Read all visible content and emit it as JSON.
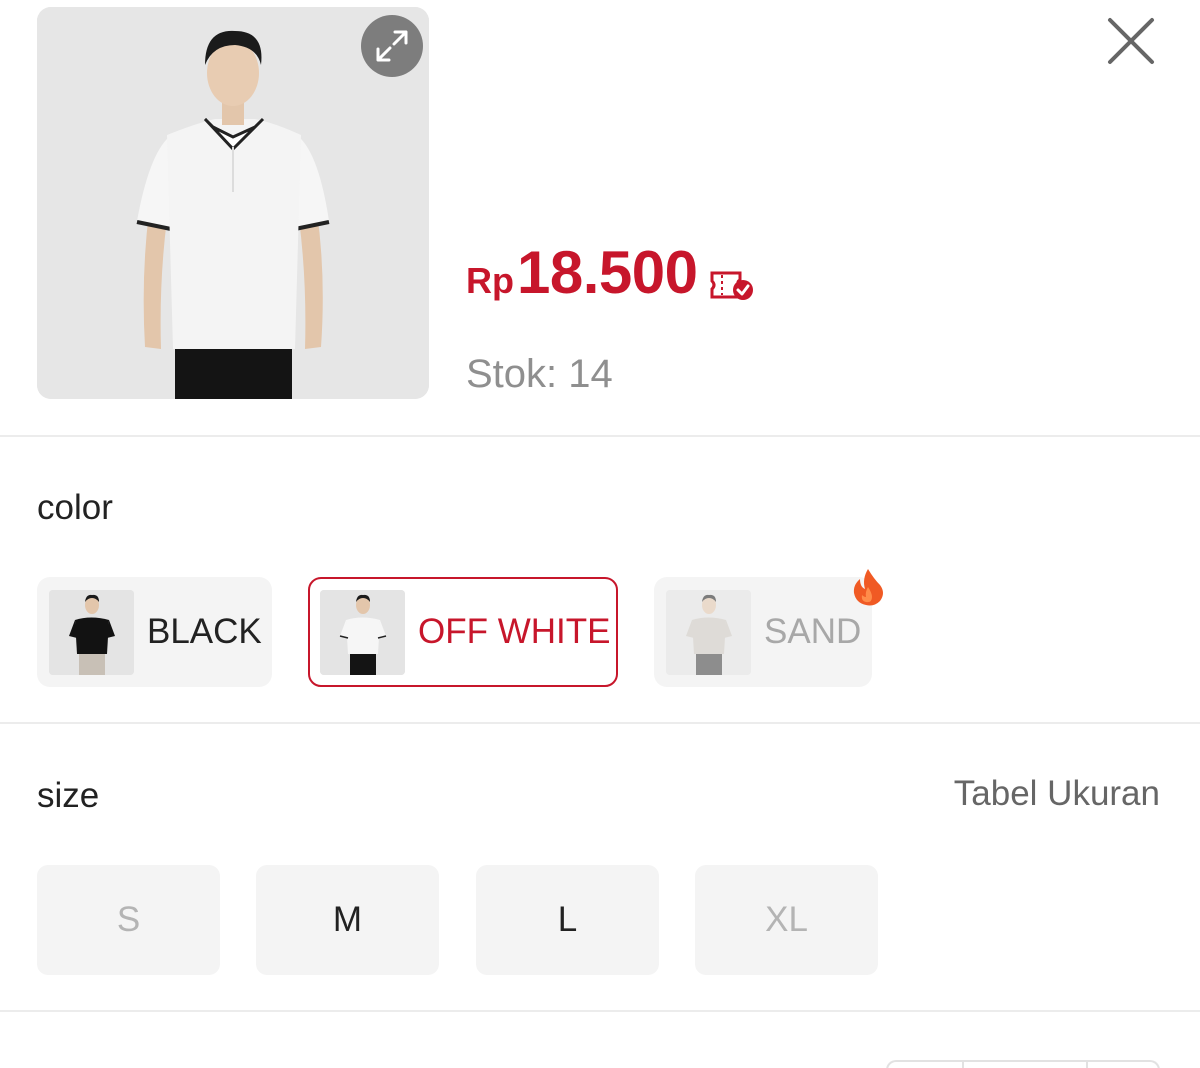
{
  "product": {
    "price_currency": "Rp",
    "price_value": "18.500",
    "stock_text": "Stok: 14"
  },
  "icons": {
    "expand": "expand-arrows-icon",
    "close": "close-icon",
    "voucher": "voucher-check-icon",
    "hot": "fire-icon"
  },
  "colors_palette": {
    "accent": "#c7162b",
    "muted_text": "#8f8f8f",
    "chip_bg": "#f4f4f4"
  },
  "color_section": {
    "title": "color",
    "options": [
      {
        "label": "BLACK",
        "state": "available"
      },
      {
        "label": "OFF WHITE",
        "state": "selected"
      },
      {
        "label": "SAND",
        "state": "disabled",
        "badge": "fire-icon"
      }
    ]
  },
  "size_section": {
    "title": "size",
    "size_chart_label": "Tabel Ukuran",
    "options": [
      {
        "label": "S",
        "state": "disabled"
      },
      {
        "label": "M",
        "state": "available"
      },
      {
        "label": "L",
        "state": "available"
      },
      {
        "label": "XL",
        "state": "disabled"
      }
    ]
  }
}
